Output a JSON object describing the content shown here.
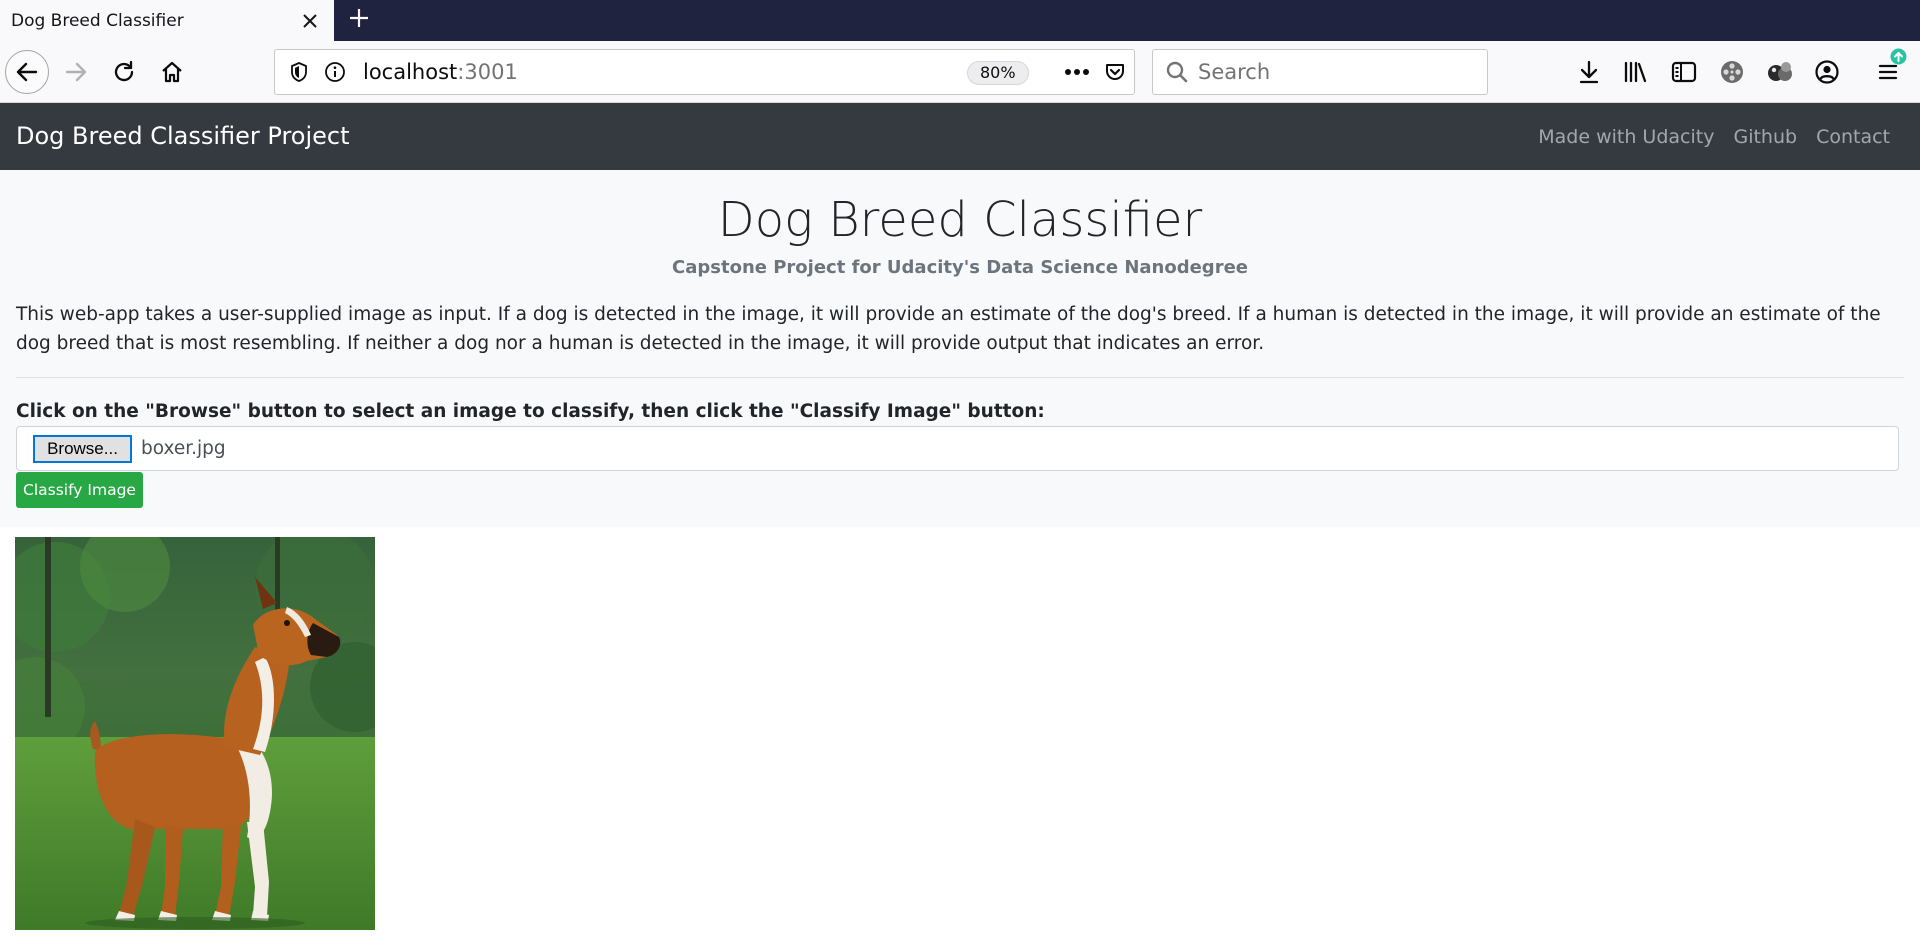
{
  "browser": {
    "tab": {
      "title": "Dog Breed Classifier"
    },
    "url": {
      "host": "localhost",
      "port": ":3001",
      "zoom": "80%"
    },
    "search": {
      "placeholder": "Search"
    },
    "colors": {
      "tabbar": "#202340",
      "toolbar": "#f9f9fb",
      "update_badge": "#2ac3a2"
    }
  },
  "site": {
    "brand": "Dog Breed Classifier Project",
    "links": [
      "Made with Udacity",
      "Github",
      "Contact"
    ],
    "colors": {
      "navbar": "#343a40",
      "jumbotron": "#f8f9fa",
      "primary_button": "#28a745"
    }
  },
  "main": {
    "title": "Dog Breed Classifier",
    "subtitle": "Capstone Project for Udacity's Data Science Nanodegree",
    "description": "This web-app takes a user-supplied image as input. If a dog is detected in the image, it will provide an estimate of the dog's breed. If a human is detected in the image, it will provide an estimate of the dog breed that is most resembling. If neither a dog nor a human is detected in the image, it will provide output that indicates an error.",
    "instructions": "Click on the \"Browse\" button to select an image to classify, then click the \"Classify Image\" button:",
    "browse_label": "Browse...",
    "file_name": "boxer.jpg",
    "classify_label": "Classify Image"
  }
}
